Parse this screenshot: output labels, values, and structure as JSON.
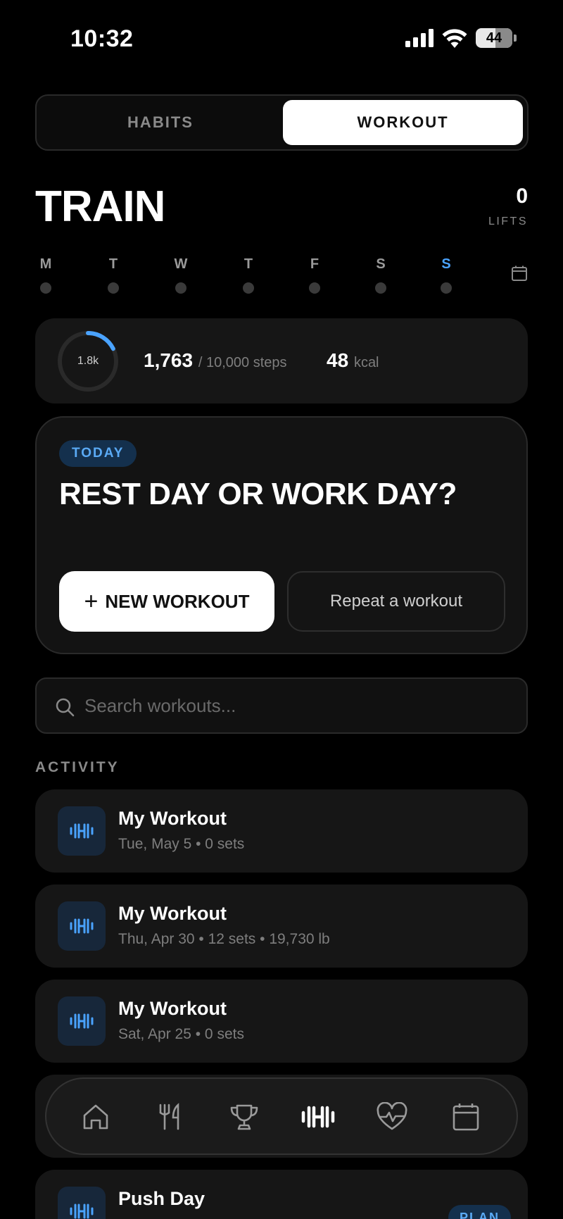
{
  "status_bar": {
    "time": "10:32",
    "battery": "44"
  },
  "segmented": {
    "habits_label": "HABITS",
    "workout_label": "WORKOUT",
    "selected": "WORKOUT"
  },
  "header": {
    "title": "TRAIN",
    "lifts_count": "0",
    "lifts_label": "LIFTS"
  },
  "week": {
    "days": [
      {
        "letter": "M",
        "active": false
      },
      {
        "letter": "T",
        "active": false
      },
      {
        "letter": "W",
        "active": false
      },
      {
        "letter": "T",
        "active": false
      },
      {
        "letter": "F",
        "active": false
      },
      {
        "letter": "S",
        "active": false
      },
      {
        "letter": "S",
        "active": true
      }
    ]
  },
  "steps": {
    "ring_label": "1.8k",
    "ring_progress": 0.1763,
    "steps_value": "1,763",
    "steps_goal": "/ 10,000 steps",
    "kcal_value": "48",
    "kcal_unit": "kcal"
  },
  "today": {
    "badge": "TODAY",
    "title": "REST DAY OR WORK DAY?",
    "new_workout_label": "NEW WORKOUT",
    "repeat_label": "Repeat a workout"
  },
  "search": {
    "placeholder": "Search workouts..."
  },
  "activity": {
    "section_label": "ACTIVITY",
    "items": [
      {
        "name": "My Workout",
        "meta": "Tue, May 5 • 0 sets"
      },
      {
        "name": "My Workout",
        "meta": "Thu, Apr 30 • 12 sets • 19,730 lb"
      },
      {
        "name": "My Workout",
        "meta": "Sat, Apr 25 • 0 sets"
      },
      {
        "name": "Push Day",
        "meta": "",
        "badge": "PLAN"
      }
    ]
  },
  "nav": {
    "items": [
      {
        "icon": "home-icon",
        "active": false
      },
      {
        "icon": "fork-knife-icon",
        "active": false
      },
      {
        "icon": "trophy-icon",
        "active": false
      },
      {
        "icon": "dumbbell-icon",
        "active": true
      },
      {
        "icon": "heart-pulse-icon",
        "active": false
      },
      {
        "icon": "calendar-icon",
        "active": false
      }
    ]
  },
  "colors": {
    "accent": "#4aa3ff",
    "background": "#000000",
    "card": "#161616"
  }
}
